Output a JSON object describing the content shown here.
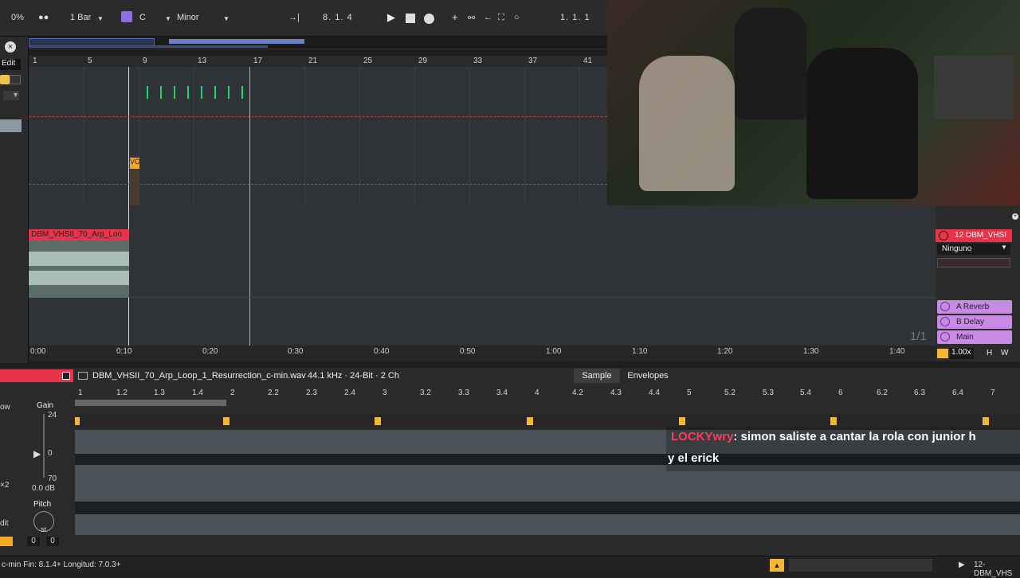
{
  "topbar": {
    "zoom_pct": "0%",
    "quantize_label": "1 Bar",
    "scale_root": "C",
    "scale_mode": "Minor",
    "position": "8.   1.   4",
    "position_right": "1.   1.   1"
  },
  "ruler": {
    "bars": [
      "1",
      "5",
      "9",
      "13",
      "17",
      "21",
      "25",
      "29",
      "33",
      "37",
      "41"
    ]
  },
  "left_strip": {
    "edit_label": "Edit",
    "edit_bottom_label": "dit"
  },
  "arrange": {
    "clip_label_vocal": "VO",
    "audio_clip_name": "DBM_VHSII_70_Arp_Loo",
    "page_indicator": "1/1"
  },
  "time_ruler": {
    "times": [
      "0:00",
      "0:10",
      "0:20",
      "0:30",
      "0:40",
      "0:50",
      "1:00",
      "1:10",
      "1:20",
      "1:30",
      "1:40"
    ]
  },
  "mixer": {
    "track_name": "12 DBM_VHSI",
    "input_select": "Ninguno",
    "returns": [
      "A Reverb",
      "B Delay",
      "Main"
    ],
    "zoom_value": "1.00x",
    "h_label": "H",
    "w_label": "W"
  },
  "clip_view": {
    "file_title": "DBM_VHSII_70_Arp_Loop_1_Resurrection_c-min.wav",
    "file_info": "44.1 kHz · 24-Bit · 2 Ch",
    "tab_sample": "Sample",
    "tab_envelopes": "Envelopes",
    "ruler_marks": [
      "1",
      "1.2",
      "1.3",
      "1.4",
      "2",
      "2.2",
      "2.3",
      "2.4",
      "3",
      "3.2",
      "3.3",
      "3.4",
      "4",
      "4.2",
      "4.3",
      "4.4",
      "5",
      "5.2",
      "5.3",
      "5.4",
      "6",
      "6.2",
      "6.3",
      "6.4",
      "7"
    ],
    "gain_label": "Gain",
    "gain_top": "24",
    "gain_mid": "0",
    "gain_bottom": "70",
    "gain_value": "0.0 dB",
    "pitch_label": "Pitch",
    "pitch_unit": "st",
    "pitch_semi": "0",
    "pitch_cents": "0",
    "side_left_1": "ow",
    "side_left_2": "×2",
    "side_left_3": "dit"
  },
  "chat": {
    "username": "LOCKYwry",
    "message": ": simon saliste a cantar la rola con junior h",
    "message_line2": "y el erick"
  },
  "statusbar": {
    "text": "c-min  Fin: 8.1.4+  Longitud: 7.0.3+",
    "right_track": "12-DBM_VHS"
  },
  "colors": {
    "accent_red": "#e8334a",
    "return_purple": "#c98ae6",
    "clip_green": "#1ed760",
    "marker_yellow": "#f5b731"
  }
}
